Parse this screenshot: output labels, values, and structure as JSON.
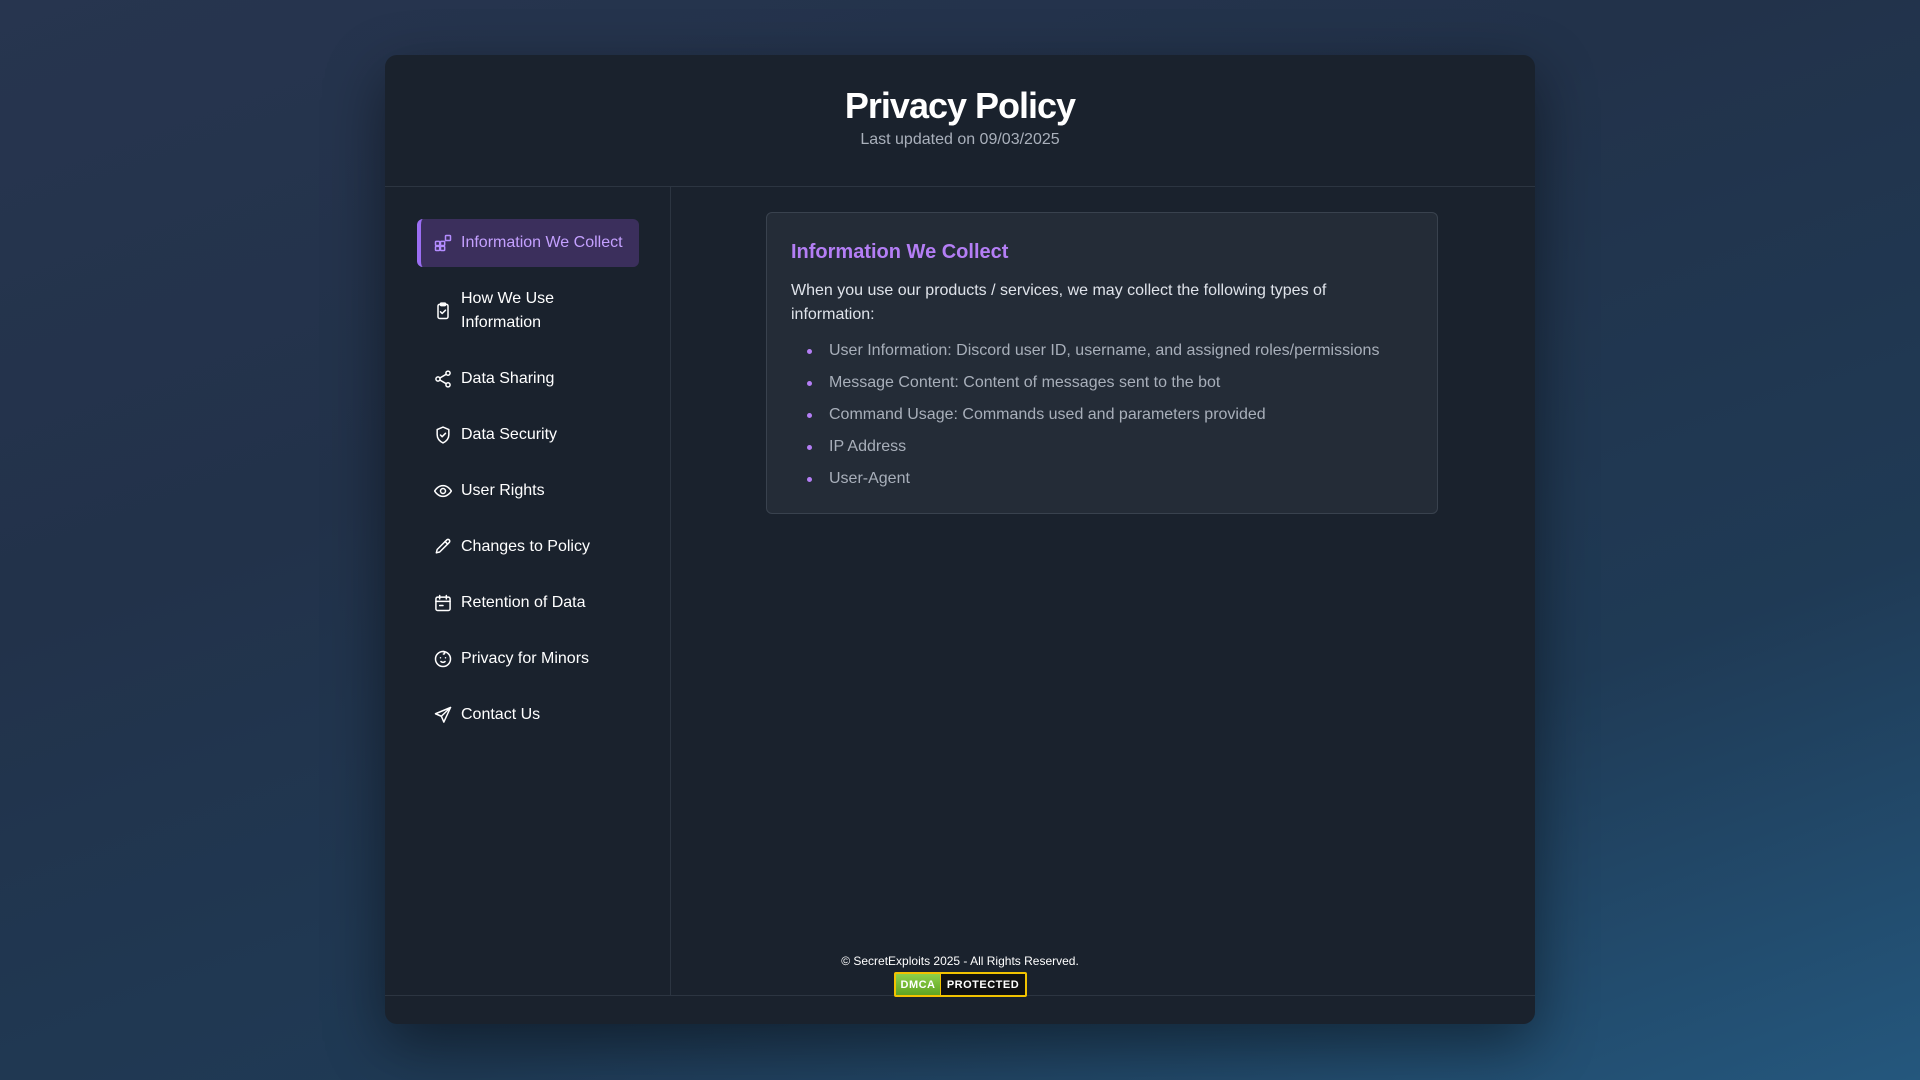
{
  "header": {
    "title": "Privacy Policy",
    "subtitle": "Last updated on 09/03/2025"
  },
  "sidebar": {
    "items": [
      {
        "label": "Information We Collect",
        "icon": "blocks-icon",
        "active": true
      },
      {
        "label": "How We Use Information",
        "icon": "clipboard-check-icon",
        "active": false
      },
      {
        "label": "Data Sharing",
        "icon": "share-icon",
        "active": false
      },
      {
        "label": "Data Security",
        "icon": "shield-check-icon",
        "active": false
      },
      {
        "label": "User Rights",
        "icon": "eye-icon",
        "active": false
      },
      {
        "label": "Changes to Policy",
        "icon": "pencil-icon",
        "active": false
      },
      {
        "label": "Retention of Data",
        "icon": "calendar-icon",
        "active": false
      },
      {
        "label": "Privacy for Minors",
        "icon": "baby-icon",
        "active": false
      },
      {
        "label": "Contact Us",
        "icon": "send-icon",
        "active": false
      }
    ]
  },
  "section": {
    "title": "Information We Collect",
    "intro": "When you use our products / services, we may collect the following types of information:",
    "items": [
      "User Information: Discord user ID, username, and assigned roles/permissions",
      "Message Content: Content of messages sent to the bot",
      "Command Usage: Commands used and parameters provided",
      "IP Address",
      "User-Agent"
    ]
  },
  "footer": {
    "copyright": "© SecretExploits 2025 - All Rights Reserved.",
    "badge_left": "DMCA",
    "badge_right": "PROTECTED"
  },
  "colors": {
    "accent": "#b47ef5",
    "active_bg": "#3b2f5c",
    "card_bg": "#1a222d",
    "badge_border": "#f2c200"
  }
}
